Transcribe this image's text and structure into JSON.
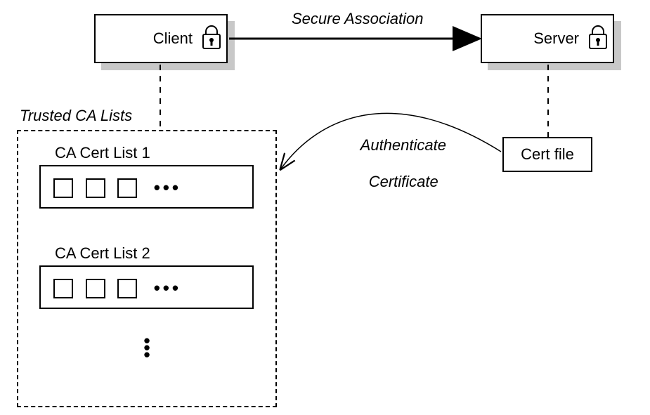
{
  "boxes": {
    "client_label": "Client",
    "server_label": "Server",
    "cert_file_label": "Cert file"
  },
  "labels": {
    "secure_association": "Secure Association",
    "trusted_ca_lists": "Trusted CA Lists",
    "authenticate_certificate_line1": "Authenticate",
    "authenticate_certificate_line2": "Certificate",
    "ca_list_1": "CA Cert List 1",
    "ca_list_2": "CA Cert List 2"
  },
  "icons": {
    "lock_client": "lock-icon",
    "lock_server": "lock-icon"
  }
}
